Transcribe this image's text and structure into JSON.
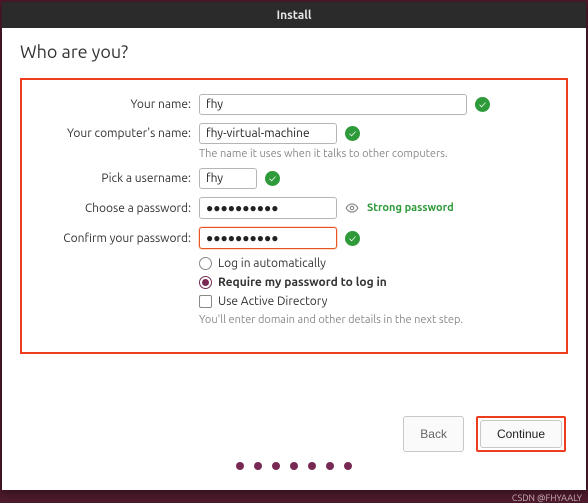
{
  "window_title": "Install",
  "page_title": "Who are you?",
  "labels": {
    "your_name": "Your name:",
    "computer_name": "Your computer's name:",
    "computer_name_hint": "The name it uses when it talks to other computers.",
    "username": "Pick a username:",
    "password": "Choose a password:",
    "confirm": "Confirm your password:"
  },
  "fields": {
    "your_name": "fhy",
    "computer_name": "fhy-virtual-machine",
    "username": "fhy",
    "password_mask": "●●●●●●●●●●",
    "confirm_mask": "●●●●●●●●●●",
    "password_strength": "Strong password"
  },
  "options": {
    "auto_login": "Log in automatically",
    "require_password": "Require my password to log in",
    "use_ad": "Use Active Directory",
    "ad_hint": "You'll enter domain and other details in the next step.",
    "selected_login": "require_password"
  },
  "buttons": {
    "back": "Back",
    "continue": "Continue"
  },
  "progress_dots": 7,
  "watermark": "CSDN @FHYAALY"
}
